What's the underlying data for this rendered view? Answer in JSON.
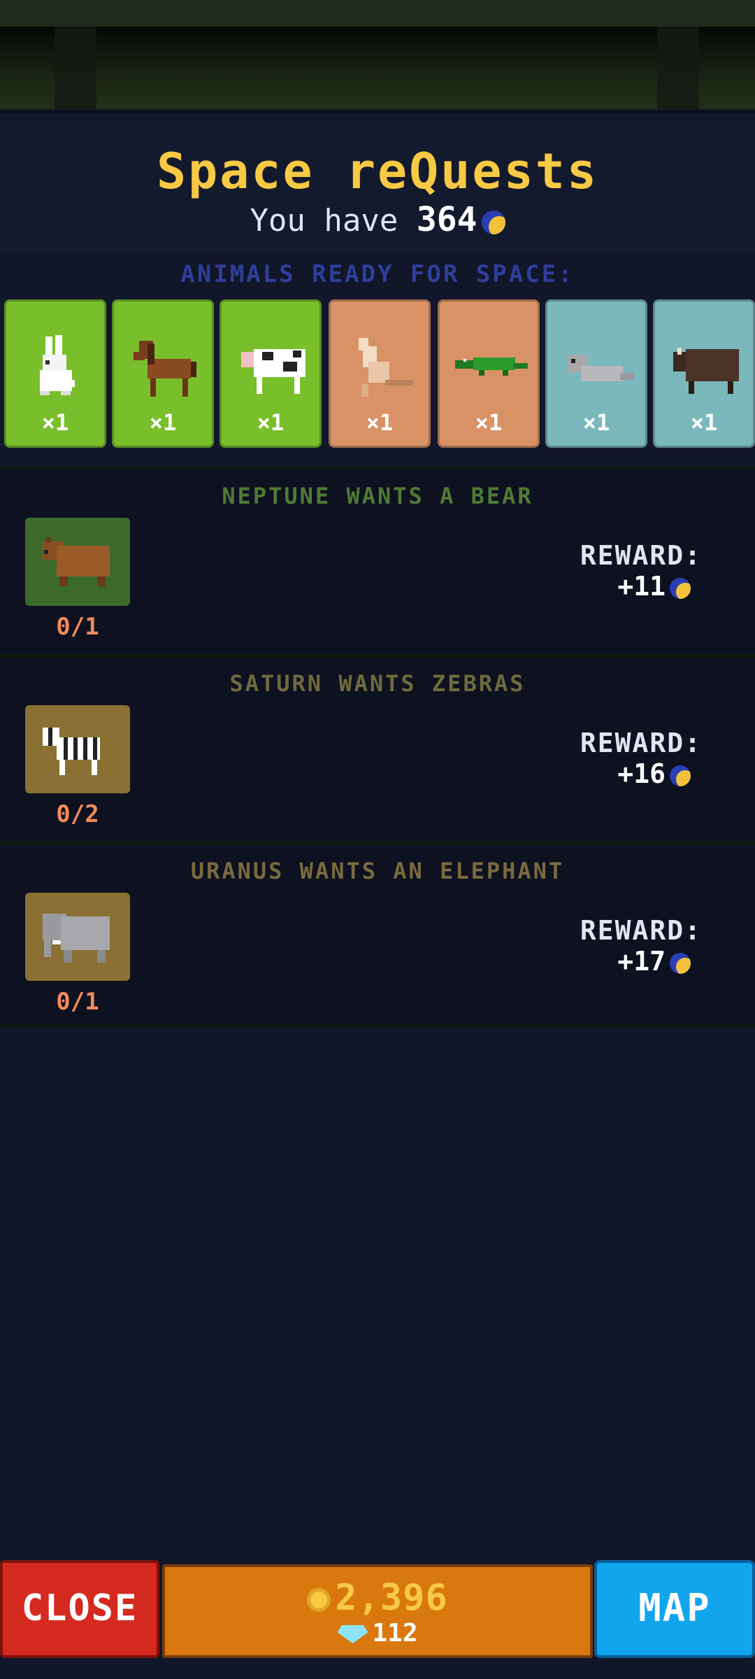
{
  "header": {
    "title": "Space reQuests",
    "balance_prefix": "You have",
    "balance_value": "364",
    "currency_icon": "moon-token-icon"
  },
  "ready": {
    "label": "ANIMALS READY FOR SPACE:",
    "animals": [
      {
        "name": "rabbit",
        "count": "×1",
        "color": "#79bf2b"
      },
      {
        "name": "horse",
        "count": "×1",
        "color": "#79bf2b"
      },
      {
        "name": "cow",
        "count": "×1",
        "color": "#79bf2b"
      },
      {
        "name": "kangaroo",
        "count": "×1",
        "color": "#d99266"
      },
      {
        "name": "crocodile",
        "count": "×1",
        "color": "#d99266"
      },
      {
        "name": "seal",
        "count": "×1",
        "color": "#7ab8bc"
      },
      {
        "name": "yak",
        "count": "×1",
        "color": "#7ab8bc"
      }
    ]
  },
  "quests": [
    {
      "title": "NEPTUNE WANTS A BEAR",
      "title_color": "#4f7a34",
      "progress": "0/1",
      "reward_label": "REWARD:",
      "reward": "+11",
      "icon": "bear-icon",
      "box_color": "#3c6a2c"
    },
    {
      "title": "SATURN WANTS ZEBRAS",
      "title_color": "#6f6a3e",
      "progress": "0/2",
      "reward_label": "REWARD:",
      "reward": "+16",
      "icon": "zebra-icon",
      "box_color": "#8a7032"
    },
    {
      "title": "URANUS WANTS AN ELEPHANT",
      "title_color": "#7a6a3e",
      "progress": "0/1",
      "reward_label": "REWARD:",
      "reward": "+17",
      "icon": "elephant-icon",
      "box_color": "#8a7032"
    }
  ],
  "bottom": {
    "close_label": "CLOSE",
    "coins": "2,396",
    "gems": "112",
    "map_label": "MAP"
  }
}
